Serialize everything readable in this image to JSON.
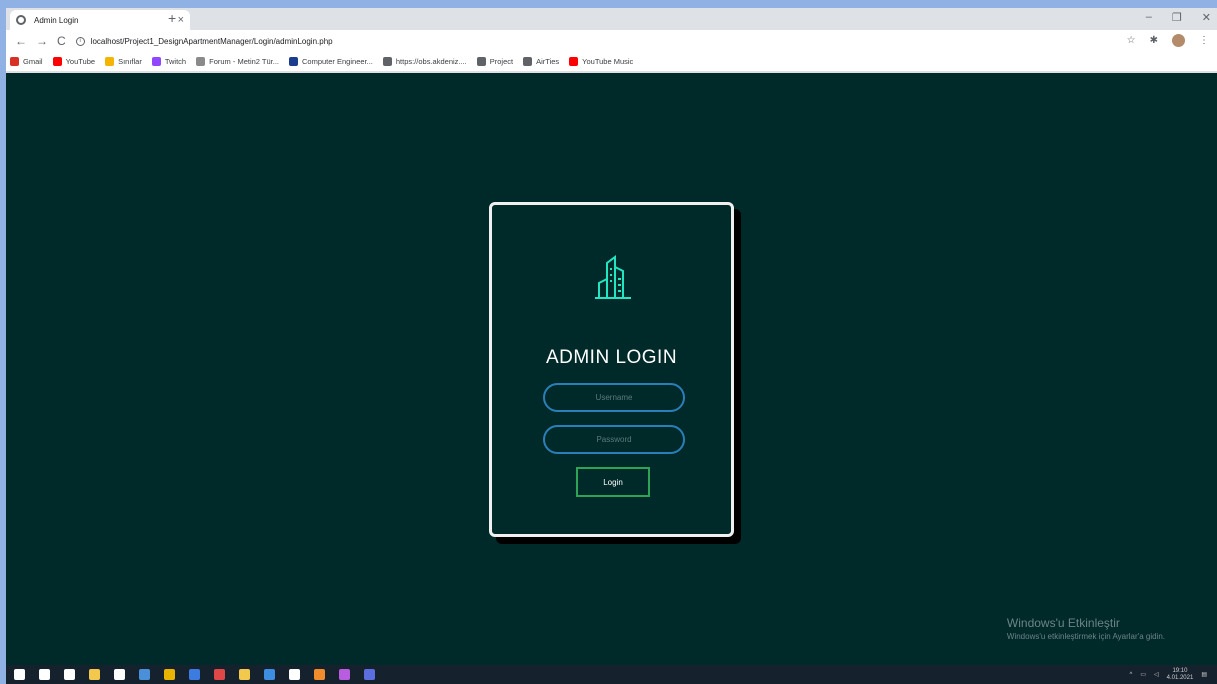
{
  "browser": {
    "tab_title": "Admin Login",
    "tab_close": "×",
    "new_tab": "+",
    "window_controls": [
      "–",
      "❐",
      "✕"
    ],
    "back": "←",
    "forward": "→",
    "reload": "C",
    "url": "localhost/Project1_DesignApartmentManager/Login/adminLogin.php",
    "bookmarks": [
      {
        "label": "Gmail",
        "icon": "gmail-icon",
        "color": "#d93025"
      },
      {
        "label": "YouTube",
        "icon": "youtube-icon",
        "color": "#ff0000"
      },
      {
        "label": "Sınıflar",
        "icon": "classroom-icon",
        "color": "#f4b400"
      },
      {
        "label": "Twitch",
        "icon": "twitch-icon",
        "color": "#9146ff"
      },
      {
        "label": "Forum - Metin2 Tür...",
        "icon": "forum-icon",
        "color": "#8a8a8a"
      },
      {
        "label": "Computer Engineer...",
        "icon": "globe-icon",
        "color": "#1a3d8f"
      },
      {
        "label": "https://obs.akdeniz....",
        "icon": "globe-icon",
        "color": "#5f6368"
      },
      {
        "label": "Project",
        "icon": "globe-icon",
        "color": "#5f6368"
      },
      {
        "label": "AirTies",
        "icon": "globe-icon",
        "color": "#5f6368"
      },
      {
        "label": "YouTube Music",
        "icon": "youtube-music-icon",
        "color": "#ff0000"
      }
    ]
  },
  "login": {
    "heading": "ADMIN LOGIN",
    "username_placeholder": "Username",
    "password_placeholder": "Password",
    "button_label": "Login",
    "logo_icon": "building-icon",
    "accent": "#21e6c1"
  },
  "watermark": {
    "line1": "Windows'u Etkinleştir",
    "line2": "Windows'u etkinleştirmek için Ayarlar'a gidin."
  },
  "taskbar": {
    "time": "19:10",
    "date": "4.01.2021",
    "icons": [
      "start-icon",
      "search-icon",
      "task-view-icon",
      "explorer-icon",
      "store-icon",
      "mail-icon",
      "chrome-icon",
      "app-icon",
      "app-icon",
      "app-icon",
      "edge-icon",
      "app-icon",
      "sublime-icon",
      "app-icon",
      "teams-icon"
    ]
  }
}
